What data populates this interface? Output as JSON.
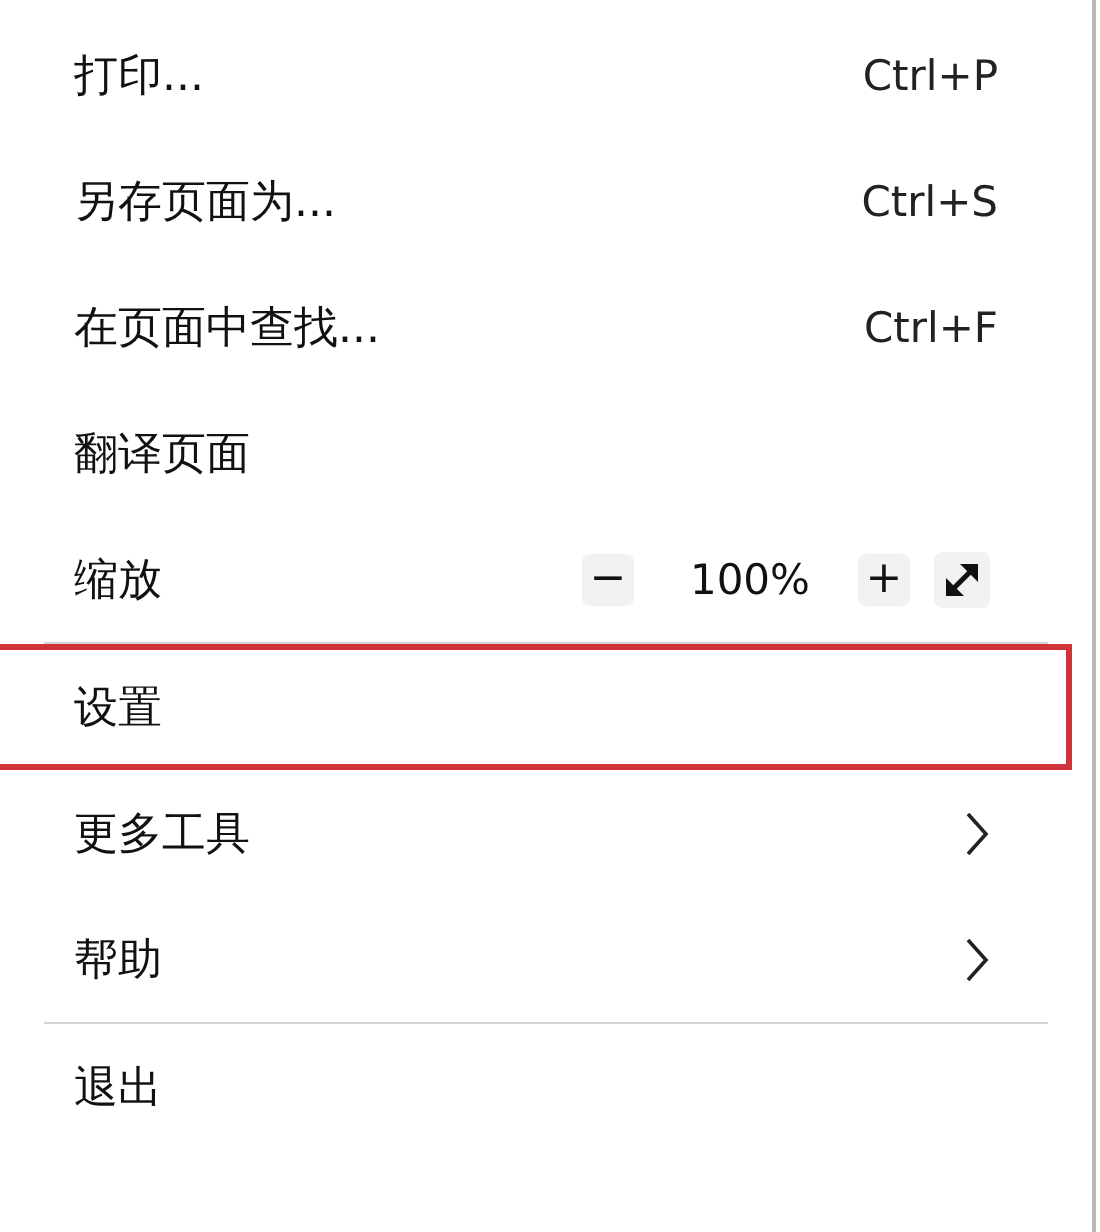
{
  "menu": {
    "items": [
      {
        "kind": "item",
        "label": "打印...",
        "shortcut": "Ctrl+P",
        "highlighted": false
      },
      {
        "kind": "item",
        "label": "另存页面为...",
        "shortcut": "Ctrl+S",
        "highlighted": false
      },
      {
        "kind": "item",
        "label": "在页面中查找...",
        "shortcut": "Ctrl+F",
        "highlighted": false
      },
      {
        "kind": "item",
        "label": "翻译页面",
        "highlighted": false
      },
      {
        "kind": "zoom",
        "label": "缩放",
        "minus": "−",
        "value": "100%",
        "plus": "+",
        "highlighted": false
      },
      {
        "kind": "divider"
      },
      {
        "kind": "item",
        "label": "设置",
        "highlighted": true
      },
      {
        "kind": "submenu",
        "label": "更多工具",
        "highlighted": false
      },
      {
        "kind": "submenu",
        "label": "帮助",
        "highlighted": false
      },
      {
        "kind": "divider"
      },
      {
        "kind": "item",
        "label": "退出",
        "highlighted": false
      }
    ]
  }
}
